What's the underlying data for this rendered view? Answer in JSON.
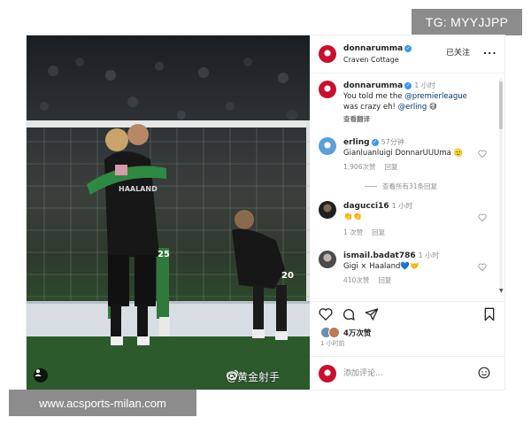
{
  "overlay": {
    "tg_badge": "TG: MYYJJPP",
    "watermark": "www.acsports-milan.com"
  },
  "photo": {
    "jersey_text_left": "HAALAND",
    "jersey_number_left": "25",
    "jersey_number_right": "20",
    "weibo_tag": "@黄金射手",
    "weibo_icon": "weibo-logo-icon",
    "user_tag_icon": "person-icon"
  },
  "post_header": {
    "username": "donnarumma",
    "location": "Craven Cottage",
    "follow_status": "已关注",
    "more_icon": "..."
  },
  "caption": {
    "username": "donnarumma",
    "time": "1 小时",
    "line1_prefix": "You told me the ",
    "mention1": "@premierleague",
    "line2_prefix": "was crazy eh! ",
    "mention2": "@erling",
    "emoji": "😅",
    "translate": "查看翻译"
  },
  "comments": [
    {
      "username": "erling",
      "verified": true,
      "time": "57分钟",
      "text": "Gianluanluigi DonnarUUUma 🫡",
      "likes": "1,906次赞",
      "reply": "回复",
      "view_replies": "查看所有31条回复"
    },
    {
      "username": "dagucci16",
      "verified": false,
      "time": "1 小时",
      "text": "👏👏",
      "likes": "1 次赞",
      "reply": "回复"
    },
    {
      "username": "ismail.badat786",
      "verified": false,
      "time": "1 小时",
      "text": "Gigi × Haaland💙🤝",
      "likes": "410次赞",
      "reply": "回复"
    }
  ],
  "actions": {
    "like_icon": "heart-icon",
    "comment_icon": "comment-icon",
    "share_icon": "send-icon",
    "save_icon": "bookmark-icon",
    "likes_count": "4万次赞",
    "post_time": "1 小时前"
  },
  "add_comment": {
    "placeholder": "添加评论...",
    "emoji_icon": "emoji-icon"
  },
  "colors": {
    "verified": "#3897f0",
    "pitch_green": "#28512a",
    "link": "#00376b",
    "muted": "#8e8e8e"
  }
}
